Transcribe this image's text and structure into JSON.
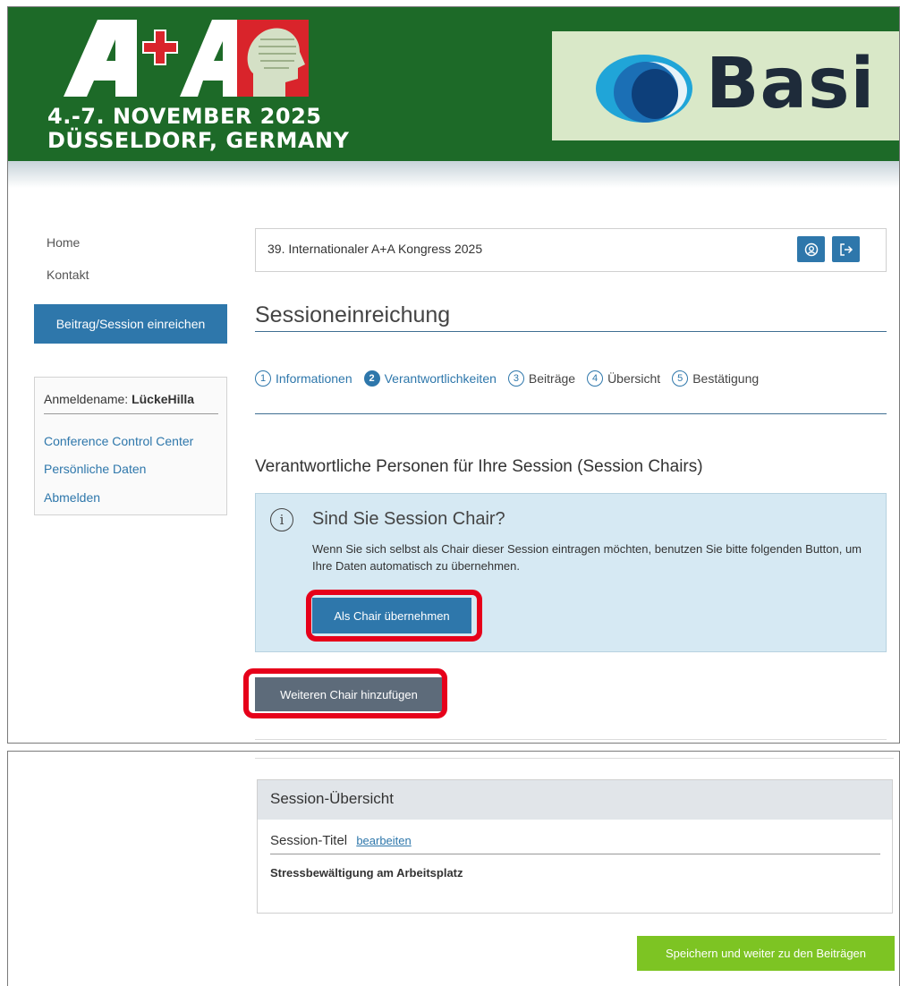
{
  "banner": {
    "logo_text": "A+A",
    "date": "4.-7. NOVEMBER 2025",
    "city": "DÜSSELDORF, GERMANY",
    "sponsor": "Basi",
    "colors": {
      "green": "#1d6a28",
      "sponsor_bg": "#d9e8c8"
    }
  },
  "sidebar": {
    "nav": [
      {
        "label": "Home"
      },
      {
        "label": "Kontakt"
      }
    ],
    "submit_button": "Beitrag/Session einreichen",
    "user_label": "Anmeldename:",
    "user_name": "LückeHilla",
    "links": [
      {
        "label": "Conference Control Center"
      },
      {
        "label": "Persönliche Daten"
      },
      {
        "label": "Abmelden"
      }
    ]
  },
  "header": {
    "congress_title": "39. Internationaler A+A Kongress 2025",
    "icons": [
      "user-circle-icon",
      "logout-icon"
    ]
  },
  "main": {
    "page_title": "Sessioneinreichung",
    "steps": [
      {
        "number": "1",
        "label": "Informationen"
      },
      {
        "number": "2",
        "label": "Verantwortlichkeiten",
        "active": true
      },
      {
        "number": "3",
        "label": "Beiträge"
      },
      {
        "number": "4",
        "label": "Übersicht"
      },
      {
        "number": "5",
        "label": "Bestätigung"
      }
    ],
    "section_heading": "Verantwortliche Personen für Ihre Session (Session Chairs)",
    "info": {
      "icon": "info-icon",
      "heading": "Sind Sie Session Chair?",
      "text": "Wenn Sie sich selbst als Chair dieser Session eintragen möchten, benutzen Sie bitte folgenden Button, um Ihre Daten automatisch zu übernehmen.",
      "button": "Als Chair übernehmen"
    },
    "add_chair_button": "Weiteren Chair hinzufügen",
    "highlight_color": "#e6001a"
  },
  "overview": {
    "heading": "Session-Übersicht",
    "field_label": "Session-Titel",
    "edit_link": "bearbeiten",
    "title_value": "Stressbewältigung am Arbeitsplatz",
    "save_button": "Speichern und weiter zu den Beiträgen"
  }
}
